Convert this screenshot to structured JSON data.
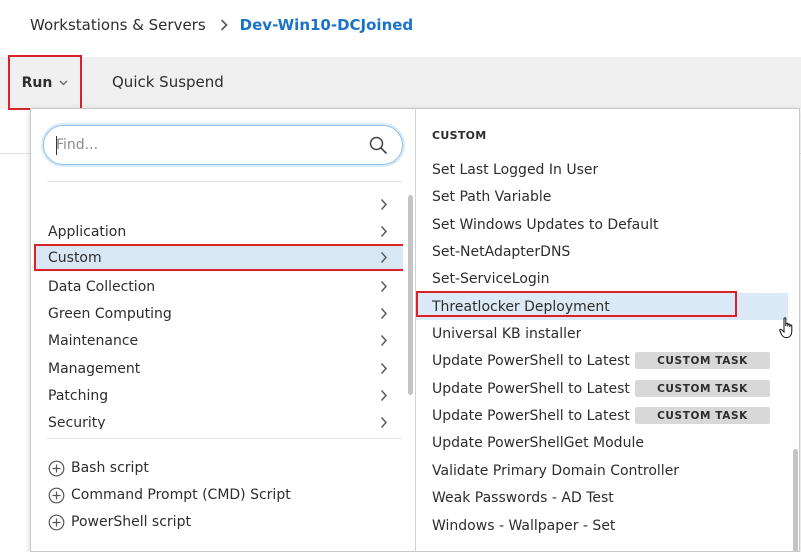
{
  "breadcrumb": {
    "root": "Workstations & Servers",
    "current": "Dev-Win10-DCJoined"
  },
  "toolbar": {
    "run_label": "Run",
    "quick_suspend_label": "Quick Suspend"
  },
  "search": {
    "placeholder": "Find...",
    "icon": "search-icon"
  },
  "categories": [
    {
      "label": "",
      "selected": false
    },
    {
      "label": "Application",
      "selected": false
    },
    {
      "label": "Custom",
      "selected": true
    },
    {
      "label": "Data Collection",
      "selected": false
    },
    {
      "label": "Green Computing",
      "selected": false
    },
    {
      "label": "Maintenance",
      "selected": false
    },
    {
      "label": "Management",
      "selected": false
    },
    {
      "label": "Patching",
      "selected": false
    },
    {
      "label": "Security",
      "selected": false
    }
  ],
  "scripts": [
    {
      "label": "Bash script",
      "icon": "plus-circle-icon"
    },
    {
      "label": "Command Prompt (CMD) Script",
      "icon": "plus-circle-icon"
    },
    {
      "label": "PowerShell script",
      "icon": "plus-circle-icon"
    }
  ],
  "custom_section": {
    "title": "CUSTOM",
    "items": [
      {
        "label": "Set Last Logged In User",
        "badge": ""
      },
      {
        "label": "Set Path Variable",
        "badge": ""
      },
      {
        "label": "Set Windows Updates to Default",
        "badge": ""
      },
      {
        "label": "Set-NetAdapterDNS",
        "badge": ""
      },
      {
        "label": "Set-ServiceLogin",
        "badge": ""
      },
      {
        "label": "Threatlocker Deployment",
        "badge": "",
        "highlighted": true
      },
      {
        "label": "Universal KB installer",
        "badge": ""
      },
      {
        "label": "Update PowerShell to Latest ...",
        "badge": "CUSTOM TASK"
      },
      {
        "label": "Update PowerShell to Latest ...",
        "badge": "CUSTOM TASK"
      },
      {
        "label": "Update PowerShell to Latest ...",
        "badge": "CUSTOM TASK"
      },
      {
        "label": "Update PowerShellGet Module",
        "badge": ""
      },
      {
        "label": "Validate Primary Domain Controller",
        "badge": ""
      },
      {
        "label": "Weak Passwords - AD Test",
        "badge": ""
      },
      {
        "label": "Windows - Wallpaper - Set",
        "badge": ""
      }
    ]
  },
  "colors": {
    "accent": "#1a73c8",
    "highlight_border": "#d9232a",
    "selected_bg": "#d9e7f5",
    "badge_bg": "#d8d8d8"
  }
}
